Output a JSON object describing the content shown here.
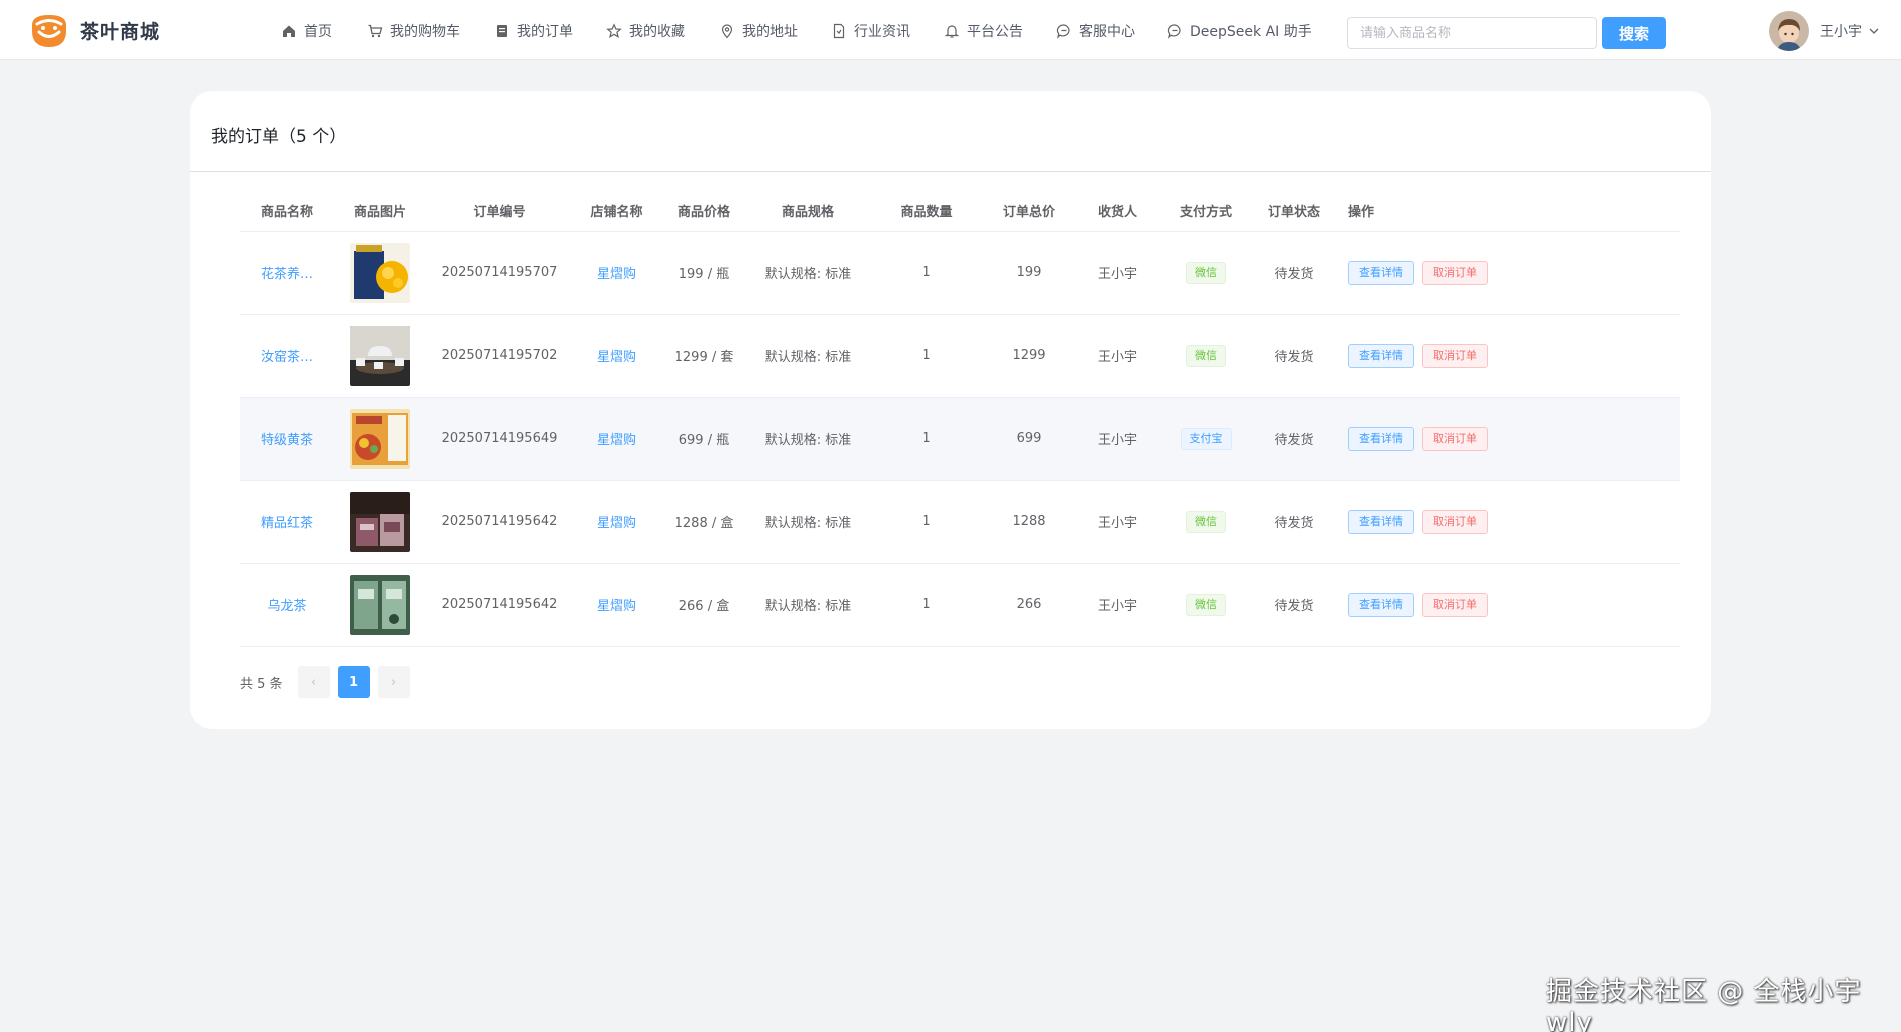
{
  "app": {
    "logo_text": "茶叶商城"
  },
  "nav": [
    {
      "label": "首页",
      "icon": "home-icon"
    },
    {
      "label": "我的购物车",
      "icon": "cart-icon"
    },
    {
      "label": "我的订单",
      "icon": "order-icon"
    },
    {
      "label": "我的收藏",
      "icon": "star-icon"
    },
    {
      "label": "我的地址",
      "icon": "location-icon"
    },
    {
      "label": "行业资讯",
      "icon": "document-icon"
    },
    {
      "label": "平台公告",
      "icon": "bell-icon"
    },
    {
      "label": "客服中心",
      "icon": "chat-icon"
    },
    {
      "label": "DeepSeek AI 助手",
      "icon": "chat-icon"
    }
  ],
  "search": {
    "placeholder": "请输入商品名称",
    "value": "",
    "button_label": "搜索"
  },
  "user": {
    "name": "王小宇"
  },
  "orders": {
    "title": "我的订单（5 个）",
    "columns": [
      "商品名称",
      "商品图片",
      "订单编号",
      "店铺名称",
      "商品价格",
      "商品规格",
      "商品数量",
      "订单总价",
      "收货人",
      "支付方式",
      "订单状态",
      "操作"
    ],
    "rows": [
      {
        "name": "花茶养…",
        "image": "tea-flower-box",
        "order_no": "20250714195707",
        "shop": "星熠购",
        "price": "199 / 瓶",
        "spec": "默认规格: 标准",
        "qty": "1",
        "total": "199",
        "receiver": "王小宇",
        "payment": "微信",
        "status": "待发货"
      },
      {
        "name": "汝窑茶…",
        "image": "tea-set",
        "order_no": "20250714195702",
        "shop": "星熠购",
        "price": "1299 / 套",
        "spec": "默认规格: 标准",
        "qty": "1",
        "total": "1299",
        "receiver": "王小宇",
        "payment": "微信",
        "status": "待发货"
      },
      {
        "name": "特级黄茶",
        "image": "yellow-tea-box",
        "order_no": "20250714195649",
        "shop": "星熠购",
        "price": "699 / 瓶",
        "spec": "默认规格: 标准",
        "qty": "1",
        "total": "699",
        "receiver": "王小宇",
        "payment": "支付宝",
        "status": "待发货"
      },
      {
        "name": "精品红茶",
        "image": "black-tea-giftbox",
        "order_no": "20250714195642",
        "shop": "星熠购",
        "price": "1288 / 盒",
        "spec": "默认规格: 标准",
        "qty": "1",
        "total": "1288",
        "receiver": "王小宇",
        "payment": "微信",
        "status": "待发货"
      },
      {
        "name": "乌龙茶",
        "image": "oolong-tea-box",
        "order_no": "20250714195642",
        "shop": "星熠购",
        "price": "266 / 盒",
        "spec": "默认规格: 标准",
        "qty": "1",
        "total": "266",
        "receiver": "王小宇",
        "payment": "微信",
        "status": "待发货"
      }
    ],
    "action_detail": "查看详情",
    "action_cancel": "取消订单"
  },
  "pagination": {
    "total_text": "共 5 条",
    "current_page": "1",
    "prev": "‹",
    "next": "›"
  },
  "watermark": "掘金技术社区 @ 全栈小宇wly",
  "colors": {
    "primary": "#409eff",
    "danger": "#f56c6c",
    "success": "#67c23a",
    "logo_orange": "#f28a2e"
  }
}
